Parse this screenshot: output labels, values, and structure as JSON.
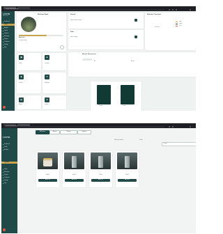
{
  "browser": {
    "address_top": "localhost:3000/dashboard",
    "address_bottom": "localhost:3000/products"
  },
  "sidebar_top": {
    "brand": "LUSTER",
    "brand_sub": "Admin Panel",
    "items": [
      {
        "label": "Dashboard"
      },
      {
        "label": "Profile"
      },
      {
        "label": "Analytics"
      },
      {
        "label": "Orders"
      },
      {
        "label": "Products"
      },
      {
        "label": "Messages"
      },
      {
        "label": "Reports"
      },
      {
        "label": "Customers"
      },
      {
        "label": "Settings"
      },
      {
        "label": "Help"
      }
    ]
  },
  "profile_card": {
    "title": "Welcome Back",
    "name": "Admin User",
    "meta": "Last login: Today",
    "progress": 0.62
  },
  "search_card": {
    "title": "Search",
    "placeholder": "Search products, orders..."
  },
  "filter_card": {
    "title": "Filter",
    "placeholder": "Select category"
  },
  "stats_card": {
    "title": "Statistics Overview",
    "legend": [
      {
        "label": "Sales",
        "color": "#c9a44e"
      },
      {
        "label": "Orders",
        "color": "#1f4a48"
      },
      {
        "label": "Visits",
        "color": "#e2574c"
      }
    ],
    "note": "This week"
  },
  "tiles": [
    {
      "label": "Orders",
      "icon": "box-icon"
    },
    {
      "label": "Customers",
      "icon": "users-icon"
    },
    {
      "label": "Products",
      "icon": "tag-icon"
    },
    {
      "label": "Messages",
      "icon": "mail-icon"
    },
    {
      "label": "Reports",
      "icon": "chart-icon"
    },
    {
      "label": "Settings",
      "icon": "gear-icon"
    }
  ],
  "documents_card": {
    "title": "Recent Documents",
    "radio_a": "All",
    "radio_b": "Recent",
    "doc_a": "Catalog",
    "doc_b": "Invoice"
  },
  "sidebar_bottom": {
    "brand": "LUSTER",
    "items": [
      {
        "label": "Dashboard"
      },
      {
        "label": "Profile"
      },
      {
        "label": "Analytics"
      },
      {
        "label": "Products"
      },
      {
        "label": "Orders"
      },
      {
        "label": "Messages"
      },
      {
        "label": "Reports"
      },
      {
        "label": "Customers"
      },
      {
        "label": "Settings"
      },
      {
        "label": "Help"
      }
    ]
  },
  "products_page": {
    "tabs": [
      {
        "label": "All Products"
      },
      {
        "label": "Skincare"
      },
      {
        "label": "Haircare"
      },
      {
        "label": "Fragrance"
      }
    ],
    "count_label": "Showing 4 products",
    "sort_label": "Sort by",
    "search_placeholder": "Search...",
    "products": [
      {
        "name": "Luxury Face Cream",
        "price": "$49.00",
        "button": "Add to Cart"
      },
      {
        "name": "Serum Drops",
        "price": "$39.00",
        "button": "Add to Cart"
      },
      {
        "name": "Body Lotion",
        "price": "$29.00",
        "button": "Add to Cart"
      },
      {
        "name": "Hair Oil",
        "price": "$25.00",
        "button": "Add to Cart"
      }
    ]
  }
}
